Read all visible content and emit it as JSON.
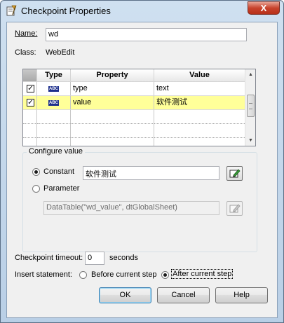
{
  "window": {
    "title": "Checkpoint Properties",
    "close_glyph": "X"
  },
  "name_field": {
    "label": "Name:",
    "value": "wd"
  },
  "class_field": {
    "label": "Class:",
    "value": "WebEdit"
  },
  "grid": {
    "headers": {
      "type": "Type",
      "property": "Property",
      "value": "Value"
    },
    "type_badge": "ABC",
    "rows": [
      {
        "checked": true,
        "property": "type",
        "value": "text",
        "selected": false
      },
      {
        "checked": true,
        "property": "value",
        "value": "软件测试",
        "selected": true
      }
    ],
    "check_glyph": "✓"
  },
  "configure": {
    "title": "Configure value",
    "constant_label": "Constant",
    "constant_value": "软件测试",
    "constant_selected": true,
    "parameter_label": "Parameter",
    "parameter_value": "DataTable(\"wd_value\", dtGlobalSheet)"
  },
  "timeout": {
    "label": "Checkpoint timeout:",
    "value": "0",
    "unit": "seconds"
  },
  "insert": {
    "label": "Insert statement:",
    "before_label": "Before current step",
    "after_label": "After current step",
    "selected": "after"
  },
  "buttons": {
    "ok": "OK",
    "cancel": "Cancel",
    "help": "Help"
  },
  "colors": {
    "selected_row": "#ffff99",
    "title_bar": "#c5d9ee",
    "close_button": "#c7432c"
  }
}
